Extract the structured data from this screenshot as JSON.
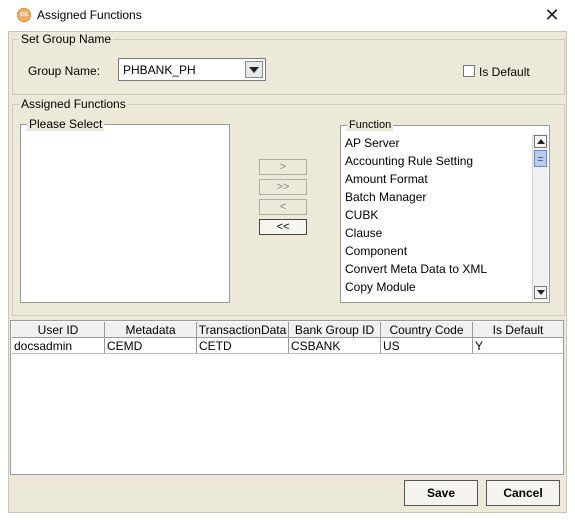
{
  "window": {
    "title": "Assigned Functions",
    "icon": "cs-logo-icon",
    "close_label": "✕"
  },
  "set_group": {
    "legend": "Set Group Name",
    "group_name_label": "Group Name:",
    "group_name_value": "PHBANK_PH",
    "is_default_label": "Is Default",
    "is_default_checked": false
  },
  "assigned": {
    "legend": "Assigned Functions",
    "please_select_legend": "Please Select",
    "please_select_items": [],
    "function_legend": "Function",
    "functions": [
      "AP Server",
      "Accounting Rule Setting",
      "Amount Format",
      "Batch Manager",
      "CUBK",
      "Clause",
      "Component",
      "Convert Meta Data to XML",
      "Copy Module"
    ],
    "buttons": {
      "add": ">",
      "add_all": ">>",
      "remove": "<",
      "remove_all": "<<"
    }
  },
  "table": {
    "headers": [
      "User ID",
      "Metadata",
      "TransactionData",
      "Bank Group ID",
      "Country Code",
      "Is Default"
    ],
    "rows": [
      [
        "docsadmin",
        "CEMD",
        "CETD",
        "CSBANK",
        "US",
        "Y"
      ]
    ]
  },
  "footer": {
    "save": "Save",
    "cancel": "Cancel"
  }
}
